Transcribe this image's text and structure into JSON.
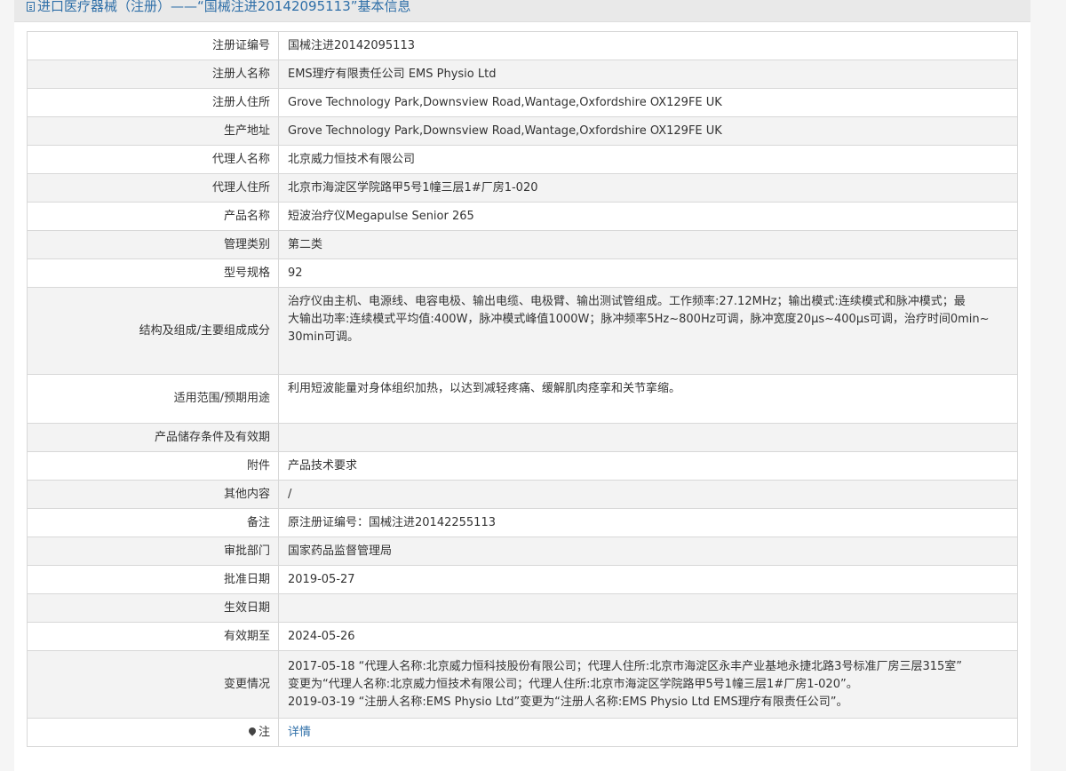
{
  "header": {
    "title": "进口医疗器械（注册）——“国械注进20142095113”基本信息",
    "icon": "document-icon"
  },
  "rows": [
    {
      "label": "注册证编号",
      "value": "国械注进20142095113"
    },
    {
      "label": "注册人名称",
      "value": "EMS理疗有限责任公司 EMS Physio Ltd"
    },
    {
      "label": "注册人住所",
      "value": "Grove Technology Park,Downsview Road,Wantage,Oxfordshire OX129FE UK"
    },
    {
      "label": "生产地址",
      "value": "Grove Technology Park,Downsview Road,Wantage,Oxfordshire OX129FE UK"
    },
    {
      "label": "代理人名称",
      "value": "北京威力恒技术有限公司"
    },
    {
      "label": "代理人住所",
      "value": "北京市海淀区学院路甲5号1幢三层1#厂房1-020"
    },
    {
      "label": "产品名称",
      "value": "短波治疗仪Megapulse Senior 265"
    },
    {
      "label": "管理类别",
      "value": "第二类"
    },
    {
      "label": "型号规格",
      "value": "92"
    },
    {
      "label": "结构及组成/主要组成成分",
      "lines": [
        "治疗仪由主机、电源线、电容电极、输出电缆、电极臂、输出测试管组成。工作频率:27.12MHz；输出模式:连续模式和脉冲模式；最",
        "大输出功率:连续模式平均值:400W，脉冲模式峰值1000W；脉冲频率5Hz~800Hz可调，脉冲宽度20μs~400μs可调，治疗时间0min~",
        "30min可调。"
      ]
    },
    {
      "label": "适用范围/预期用途",
      "value": "利用短波能量对身体组织加热，以达到减轻疼痛、缓解肌肉痉挛和关节挛缩。"
    },
    {
      "label": "产品储存条件及有效期",
      "value": ""
    },
    {
      "label": "附件",
      "value": "产品技术要求"
    },
    {
      "label": "其他内容",
      "value": "/"
    },
    {
      "label": "备注",
      "value": "原注册证编号：国械注进20142255113"
    },
    {
      "label": "审批部门",
      "value": "国家药品监督管理局"
    },
    {
      "label": "批准日期",
      "value": "2019-05-27"
    },
    {
      "label": "生效日期",
      "value": ""
    },
    {
      "label": "有效期至",
      "value": "2024-05-26"
    },
    {
      "label": "变更情况",
      "lines": [
        "2017-05-18 “代理人名称:北京威力恒科技股份有限公司；代理人住所:北京市海淀区永丰产业基地永捷北路3号标准厂房三层315室”",
        "变更为“代理人名称:北京威力恒技术有限公司；代理人住所:北京市海淀区学院路甲5号1幢三层1#厂房1-020”。",
        "2019-03-19 “注册人名称:EMS Physio Ltd”变更为“注册人名称:EMS Physio Ltd EMS理疗有限责任公司”。"
      ]
    },
    {
      "label": "注",
      "icon": "pin-icon",
      "link_text": "详情"
    }
  ]
}
